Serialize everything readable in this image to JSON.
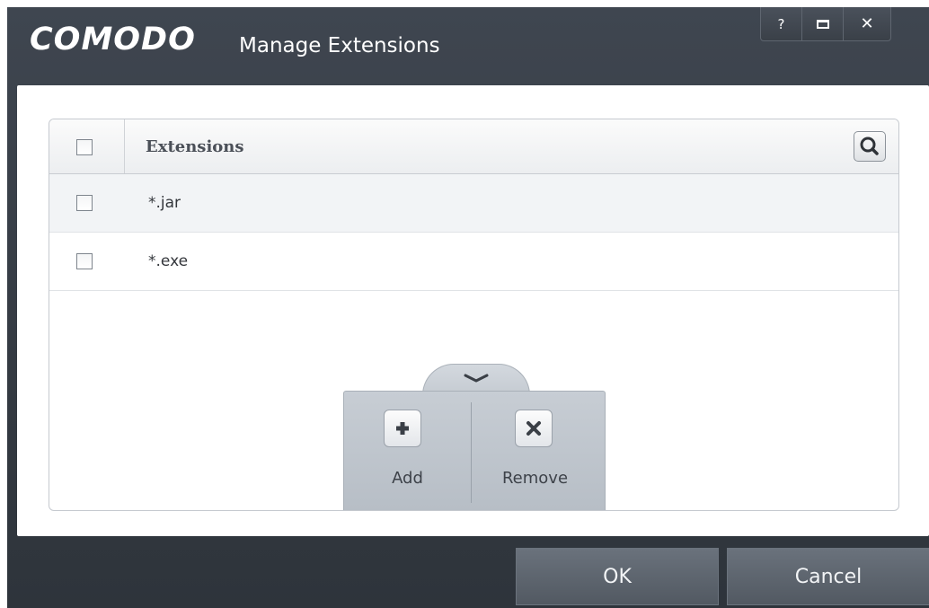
{
  "window": {
    "brand": "COMODO",
    "title": "Manage Extensions",
    "help_label": "?",
    "close_label": "✕"
  },
  "list": {
    "header_label": "Extensions",
    "rows": [
      {
        "label": "*.jar"
      },
      {
        "label": "*.exe"
      }
    ]
  },
  "actions": {
    "add_label": "Add",
    "remove_label": "Remove"
  },
  "footer": {
    "ok_label": "OK",
    "cancel_label": "Cancel"
  }
}
